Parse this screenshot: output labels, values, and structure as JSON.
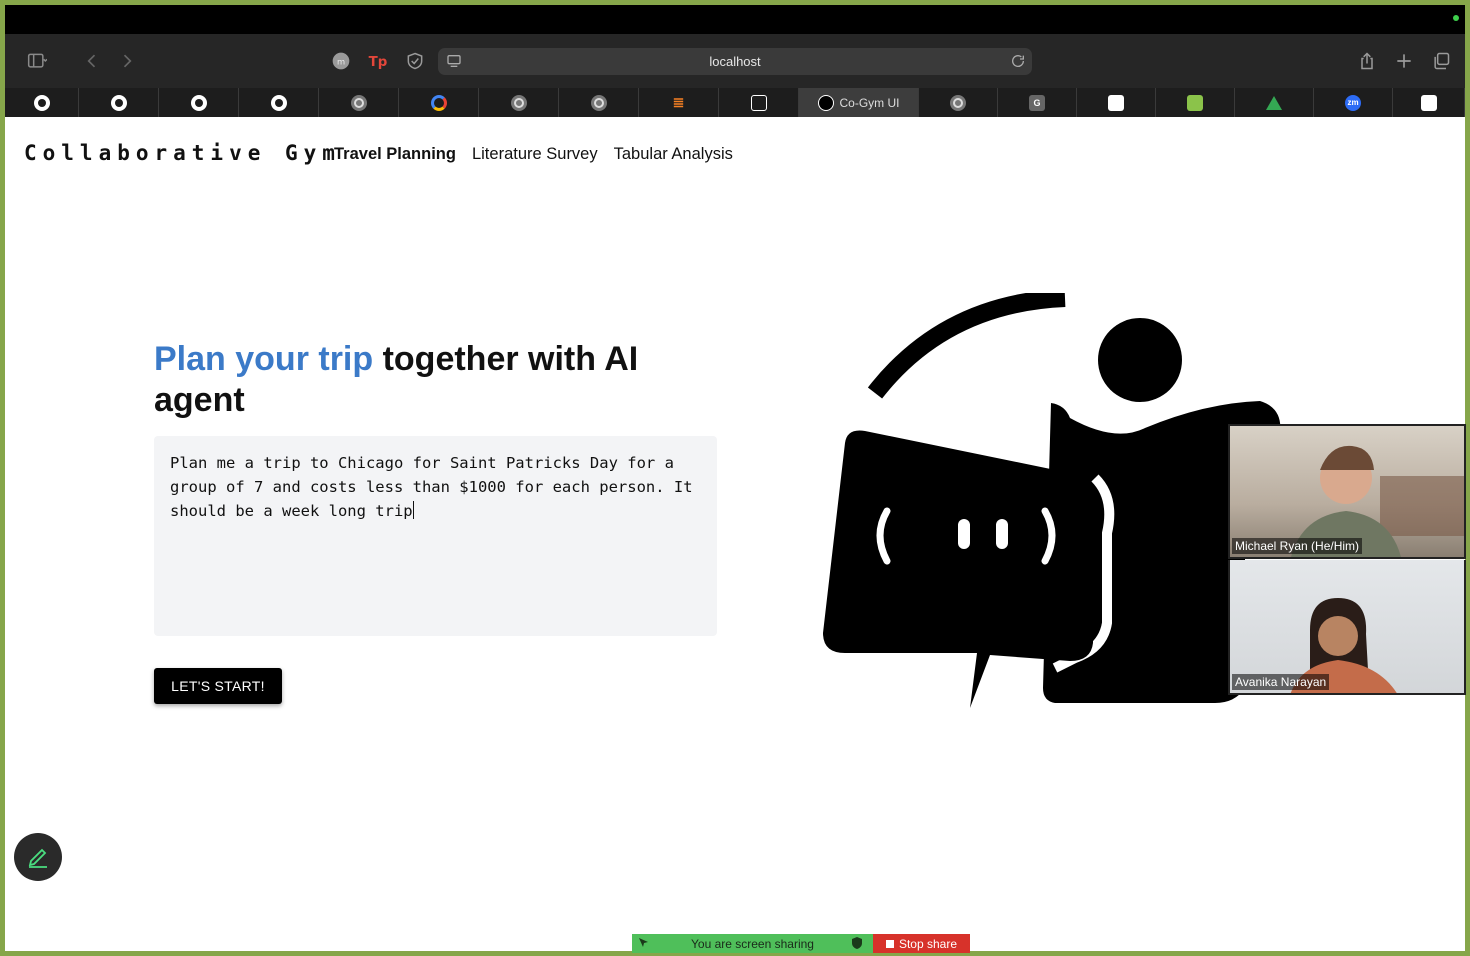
{
  "browser": {
    "url": "localhost",
    "tabs": [
      {
        "icon": "github-icon",
        "label": ""
      },
      {
        "icon": "github-icon",
        "label": ""
      },
      {
        "icon": "github-icon",
        "label": ""
      },
      {
        "icon": "github-icon",
        "label": ""
      },
      {
        "icon": "chrome-icon",
        "label": ""
      },
      {
        "icon": "google-cloud-icon",
        "label": ""
      },
      {
        "icon": "chrome-icon",
        "label": ""
      },
      {
        "icon": "chrome-icon",
        "label": ""
      },
      {
        "icon": "stackoverflow-icon",
        "label": ""
      },
      {
        "icon": "box-icon",
        "label": ""
      },
      {
        "icon": "nextjs-icon",
        "label": "Co-Gym UI",
        "active": true
      },
      {
        "icon": "chrome-icon",
        "label": ""
      },
      {
        "icon": "g-icon",
        "label": "",
        "letter": "G"
      },
      {
        "icon": "notion-icon",
        "label": ""
      },
      {
        "icon": "smiley-icon",
        "label": ""
      },
      {
        "icon": "google-drive-icon",
        "label": ""
      },
      {
        "icon": "zoom-icon",
        "label": "",
        "letter": "zm"
      },
      {
        "icon": "notion-icon",
        "label": ""
      }
    ]
  },
  "app": {
    "brand": "Collaborative Gym",
    "nav": [
      "Travel Planning",
      "Literature Survey",
      "Tabular Analysis"
    ],
    "headline_accent": "Plan your trip",
    "headline_rest": " together with AI agent",
    "prompt_value": "Plan me a trip to Chicago for Saint Patricks Day for a group of 7 and costs less than $1000 for each person. It should be a week long trip",
    "start_label": "LET'S START!"
  },
  "video_call": {
    "participants": [
      "Michael Ryan (He/Him)",
      "Avanika Narayan"
    ],
    "sharing_text": "You are screen sharing",
    "stop_label": "Stop share"
  },
  "colors": {
    "accent": "#3b7ac8",
    "window_border": "#86a64a"
  }
}
